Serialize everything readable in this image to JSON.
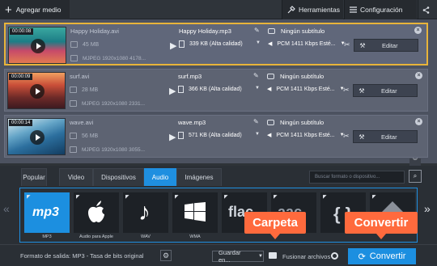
{
  "toolbar": {
    "add_media": "Agregar medio",
    "tools": "Herramientas",
    "settings": "Configuración"
  },
  "files": [
    {
      "duration": "00:00:08",
      "src_name": "Happy Holiday.avi",
      "src_size": "45 MB",
      "src_format": "MJPEG 1920x1080 4178...",
      "out_name": "Happy Holiday.mp3",
      "out_size": "339 KB (Alta calidad)",
      "subtitle": "Ningún subtítulo",
      "audio": "PCM 1411 Kbps Esté...",
      "edit_label": "Editar"
    },
    {
      "duration": "00:00:09",
      "src_name": "surf.avi",
      "src_size": "28 MB",
      "src_format": "MJPEG 1920x1080 2331...",
      "out_name": "surf.mp3",
      "out_size": "366 KB (Alta calidad)",
      "subtitle": "Ningún subtítulo",
      "audio": "PCM 1411 Kbps Esté...",
      "edit_label": "Editar"
    },
    {
      "duration": "00:00:14",
      "src_name": "wave.avi",
      "src_size": "56 MB",
      "src_format": "MJPEG 1920x1080 3055...",
      "out_name": "wave.mp3",
      "out_size": "571 KB (Alta calidad)",
      "subtitle": "Ningún subtítulo",
      "audio": "PCM 1411 Kbps Esté...",
      "edit_label": "Editar"
    }
  ],
  "tabs": [
    "Popular",
    "Video",
    "Dispositivos",
    "Audio",
    "Imágenes"
  ],
  "active_tab": "Audio",
  "search": {
    "placeholder": "Buscar formato o dispositivo..."
  },
  "formats": [
    {
      "label": "MP3",
      "logo": "mp3",
      "selected": true
    },
    {
      "label": "Audio para Apple",
      "logo": "apple-icon"
    },
    {
      "label": "WAV",
      "logo": "music-note-icon"
    },
    {
      "label": "WMA",
      "logo": "windows-icon"
    },
    {
      "label": "",
      "logo": "flac"
    },
    {
      "label": "",
      "logo": "aac"
    },
    {
      "label": "",
      "logo": "ogg"
    },
    {
      "label": "",
      "logo": "ac3"
    }
  ],
  "bottom": {
    "output_format": "Formato de salida: MP3 - Tasa de bits original",
    "save_to": "Guardar en...",
    "merge": "Fusionar archivos",
    "convert": "Convertir"
  },
  "callouts": {
    "folder": "Carpeta",
    "convert": "Convertir"
  },
  "colors": {
    "accent_blue": "#1c8fe0",
    "selection_border": "#e8b43a",
    "callout_orange": "#ff6a3d"
  }
}
